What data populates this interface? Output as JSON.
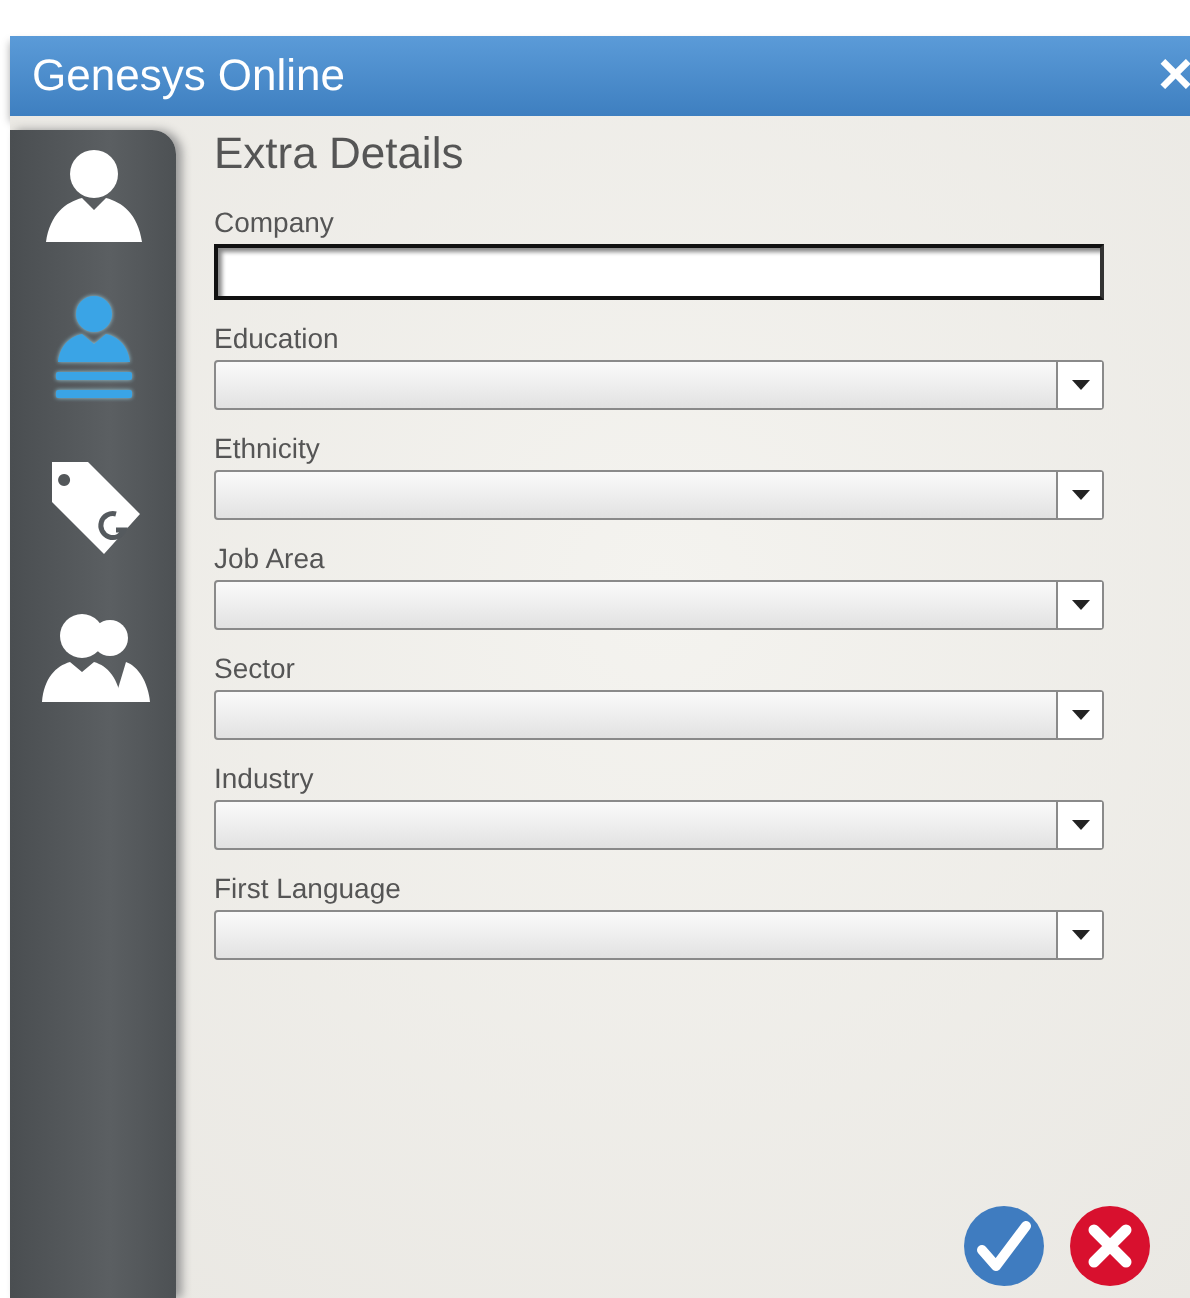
{
  "window": {
    "title": "Genesys Online",
    "close": "×"
  },
  "sidebar": {
    "items": [
      {
        "kind": "person",
        "selected": false
      },
      {
        "kind": "details",
        "selected": true
      },
      {
        "kind": "tag",
        "selected": false
      },
      {
        "kind": "group",
        "selected": false
      }
    ]
  },
  "heading": "Extra Details",
  "fields": [
    {
      "label": "Company",
      "kind": "text"
    },
    {
      "label": "Education",
      "kind": "select"
    },
    {
      "label": "Ethnicity",
      "kind": "select"
    },
    {
      "label": "Job Area",
      "kind": "select"
    },
    {
      "label": "Sector",
      "kind": "select"
    },
    {
      "label": "Industry",
      "kind": "select"
    },
    {
      "label": "First Language",
      "kind": "select"
    }
  ],
  "buttons": [
    {
      "kind": "confirm"
    },
    {
      "kind": "cancel"
    }
  ]
}
